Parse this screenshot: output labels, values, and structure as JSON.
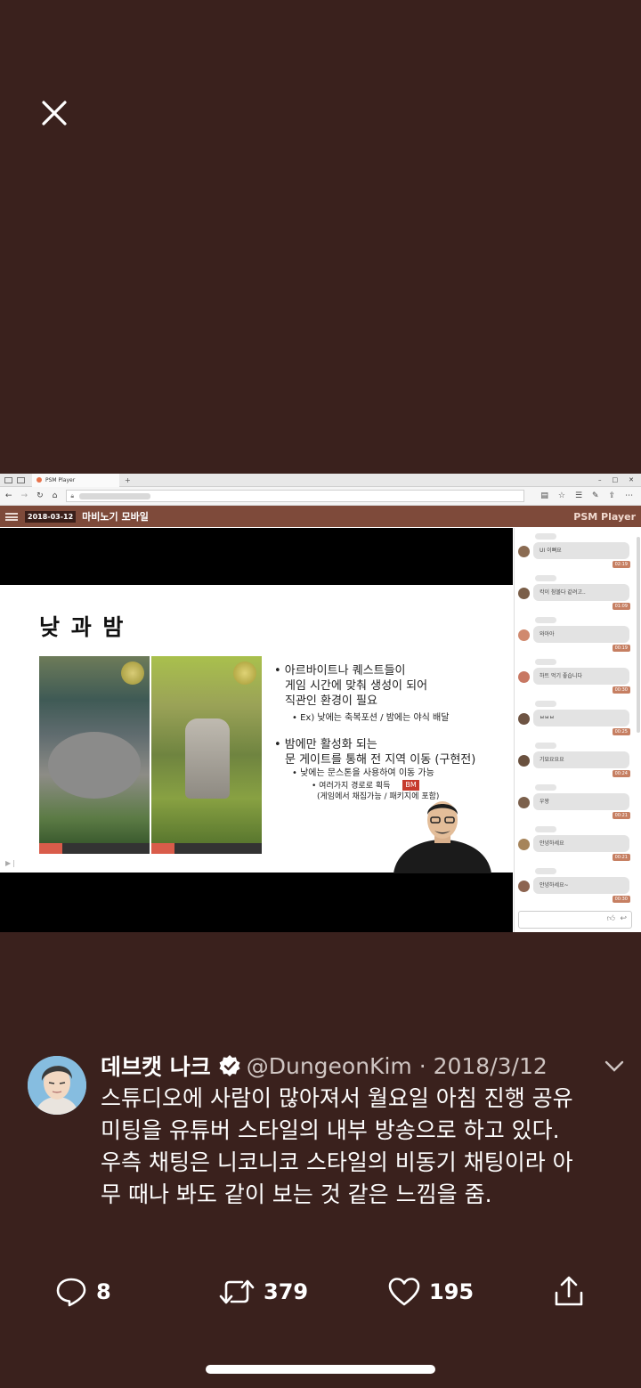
{
  "browser": {
    "tab_title": "PSM Player",
    "new_tab": "+",
    "win_controls": [
      "–",
      "□",
      "✕"
    ]
  },
  "app": {
    "date_badge": "2018-03-12",
    "title": "마비노기 모바일",
    "brand": "PSM Player"
  },
  "slide": {
    "title": "낮 과 밤",
    "bullets": [
      "• 아르바이트나 퀘스트들이",
      "게임 시간에 맞춰 생성이 되어",
      "직관인 환경이 필요",
      "• Ex) 낮에는 축복포션 / 밤에는 야식 배달",
      "• 밤에만 활성화 되는",
      "문 게이트를 통해 전 지역 이동 (구현전)",
      "• 낮에는 문스톤을 사용하여 이동 가능",
      "• 여러가지 경로로 획득",
      "(게임에서 채집가능 / 패키지에 포함)"
    ],
    "badge": "BM"
  },
  "chat": {
    "messages": [
      {
        "text": "UI 이뻐요",
        "time": "02:19",
        "avatar": "#8a6b52"
      },
      {
        "text": "칵이 참볼다 같려고..",
        "time": "01:09",
        "avatar": "#7a5e48"
      },
      {
        "text": "와아아",
        "time": "00:19",
        "avatar": "#d0896e"
      },
      {
        "text": "하트 먹기 좋습니다",
        "time": "00:30",
        "avatar": "#c87863"
      },
      {
        "text": "ㅂㅂㅂ",
        "time": "00:25",
        "avatar": "#6e5443"
      },
      {
        "text": "기묘요요요",
        "time": "00:24",
        "avatar": "#6a513f"
      },
      {
        "text": "우왕",
        "time": "00:21",
        "avatar": "#7b604c"
      },
      {
        "text": "안녕하세요",
        "time": "00:21",
        "avatar": "#a6845a"
      },
      {
        "text": "안녕하세요~",
        "time": "00:30",
        "avatar": "#8d6450"
      }
    ]
  },
  "tweet": {
    "name": "데브캣 나크",
    "meta": "@DungeonKim · 2018/3/12",
    "lines": [
      "스튜디오에 사람이 많아져서 월요일 아침 진행 공유",
      "미팅을 유튜버 스타일의 내부 방송으로 하고 있다.",
      "우측 채팅은 니코니코 스타일의 비동기 채팅이라 아",
      "무 때나 봐도 같이 보는 것 같은 느낌을 줌."
    ],
    "replies": "8",
    "retweets": "379",
    "likes": "195"
  },
  "colors": {
    "background": "#3a211d",
    "app_bar": "#7e4a3a",
    "time_tag": "#c67f62"
  }
}
